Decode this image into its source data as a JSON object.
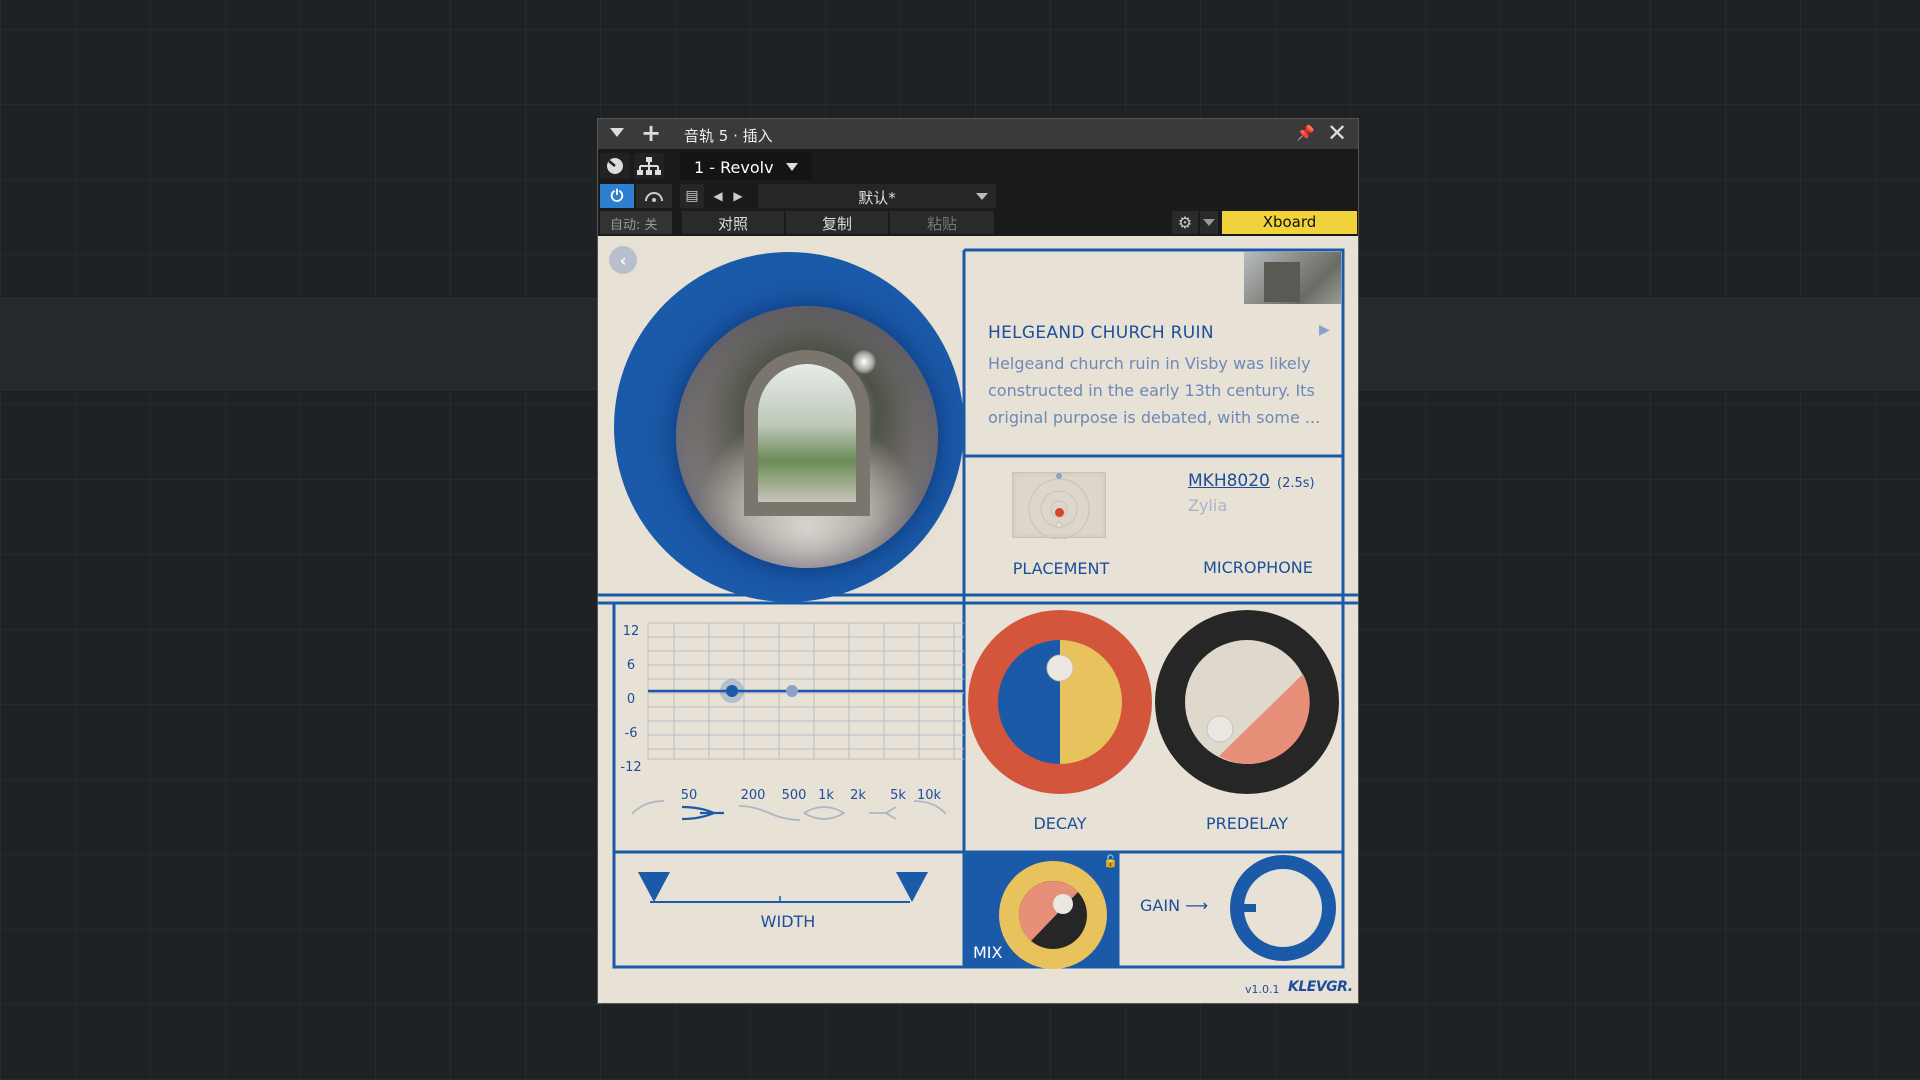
{
  "host": {
    "title": "音轨 5 · 插入",
    "preset_slot": "1 - Revolv",
    "preset_name": "默认*",
    "automation": "自动: 关",
    "compare": "对照",
    "copy": "复制",
    "paste": "粘贴",
    "xboard": "Xboard"
  },
  "location": {
    "name": "HELGEAND CHURCH RUIN",
    "description": "Helgeand church ruin in Visby was likely constructed in the early 13th century. Its original purpose is debated, with some ..."
  },
  "placement": {
    "label": "PLACEMENT"
  },
  "microphone": {
    "model": "MKH8020",
    "length": "(2.5s)",
    "brand": "Zylia",
    "label": "MICROPHONE"
  },
  "eq": {
    "y_ticks": [
      "12",
      "6",
      "0",
      "-6",
      "-12"
    ],
    "x_ticks": [
      "50",
      "200",
      "500",
      "1k",
      "2k",
      "5k",
      "10k"
    ]
  },
  "decay": {
    "label": "DECAY",
    "colors": {
      "ring": "#d3553b",
      "left": "#1a5aa8",
      "right": "#e8c25c"
    }
  },
  "predelay": {
    "label": "PREDELAY",
    "colors": {
      "ring": "#262626",
      "fill": "#e88f7a"
    }
  },
  "width": {
    "label": "WIDTH"
  },
  "mix": {
    "label": "MIX"
  },
  "gain": {
    "label": "GAIN"
  },
  "footer": {
    "version": "v1.0.1",
    "brand": "KLEVGR."
  },
  "colors": {
    "accent": "#1a5aa8",
    "panel": "#e7e1d6",
    "xboard": "#f2d23a"
  }
}
